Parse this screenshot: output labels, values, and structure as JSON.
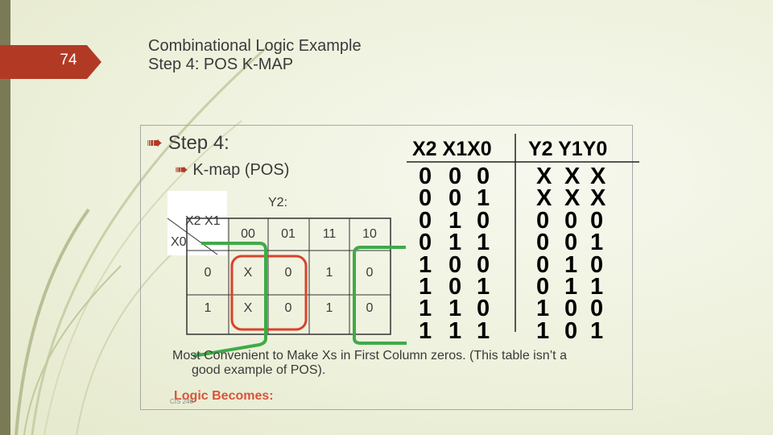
{
  "slide": {
    "page_number": "74",
    "title_line1": "Combinational Logic Example",
    "title_line2": "Step 4: POS K-MAP",
    "footer": "CIS 240",
    "accent_color": "#b23a25",
    "sidebar_color": "#7b7a56"
  },
  "bullets": {
    "level1": "Step 4:",
    "level2": "K-map (POS)",
    "arrow_icon": "arrow-right-icon"
  },
  "kmap": {
    "title": "Y2:",
    "row_var": "X0",
    "col_var": "X2 X1",
    "col_headers": [
      "00",
      "01",
      "11",
      "10"
    ],
    "rows": [
      {
        "label": "0",
        "cells": [
          "X",
          "0",
          "1",
          "0"
        ]
      },
      {
        "label": "1",
        "cells": [
          "X",
          "0",
          "1",
          "0"
        ]
      }
    ],
    "red_group_color": "#d9432c",
    "green_group_color": "#3faa49"
  },
  "truth_table": {
    "input_header": "X2 X1X0",
    "output_header": "Y2 Y1Y0",
    "rows": [
      {
        "in": [
          "0",
          "0",
          "0"
        ],
        "out": [
          "X",
          "X",
          "X"
        ]
      },
      {
        "in": [
          "0",
          "0",
          "1"
        ],
        "out": [
          "X",
          "X",
          "X"
        ]
      },
      {
        "in": [
          "0",
          "1",
          "0"
        ],
        "out": [
          "0",
          "0",
          "0"
        ]
      },
      {
        "in": [
          "0",
          "1",
          "1"
        ],
        "out": [
          "0",
          "0",
          "1"
        ]
      },
      {
        "in": [
          "1",
          "0",
          "0"
        ],
        "out": [
          "0",
          "1",
          "0"
        ]
      },
      {
        "in": [
          "1",
          "0",
          "1"
        ],
        "out": [
          "0",
          "1",
          "1"
        ]
      },
      {
        "in": [
          "1",
          "1",
          "0"
        ],
        "out": [
          "1",
          "0",
          "0"
        ]
      },
      {
        "in": [
          "1",
          "1",
          "1"
        ],
        "out": [
          "1",
          "0",
          "1"
        ]
      }
    ]
  },
  "note": {
    "line1": "Most Convenient to Make Xs in First Column zeros. (This table isn’t a",
    "line2": "good example of POS)."
  },
  "logic_label": "Logic Becomes:"
}
